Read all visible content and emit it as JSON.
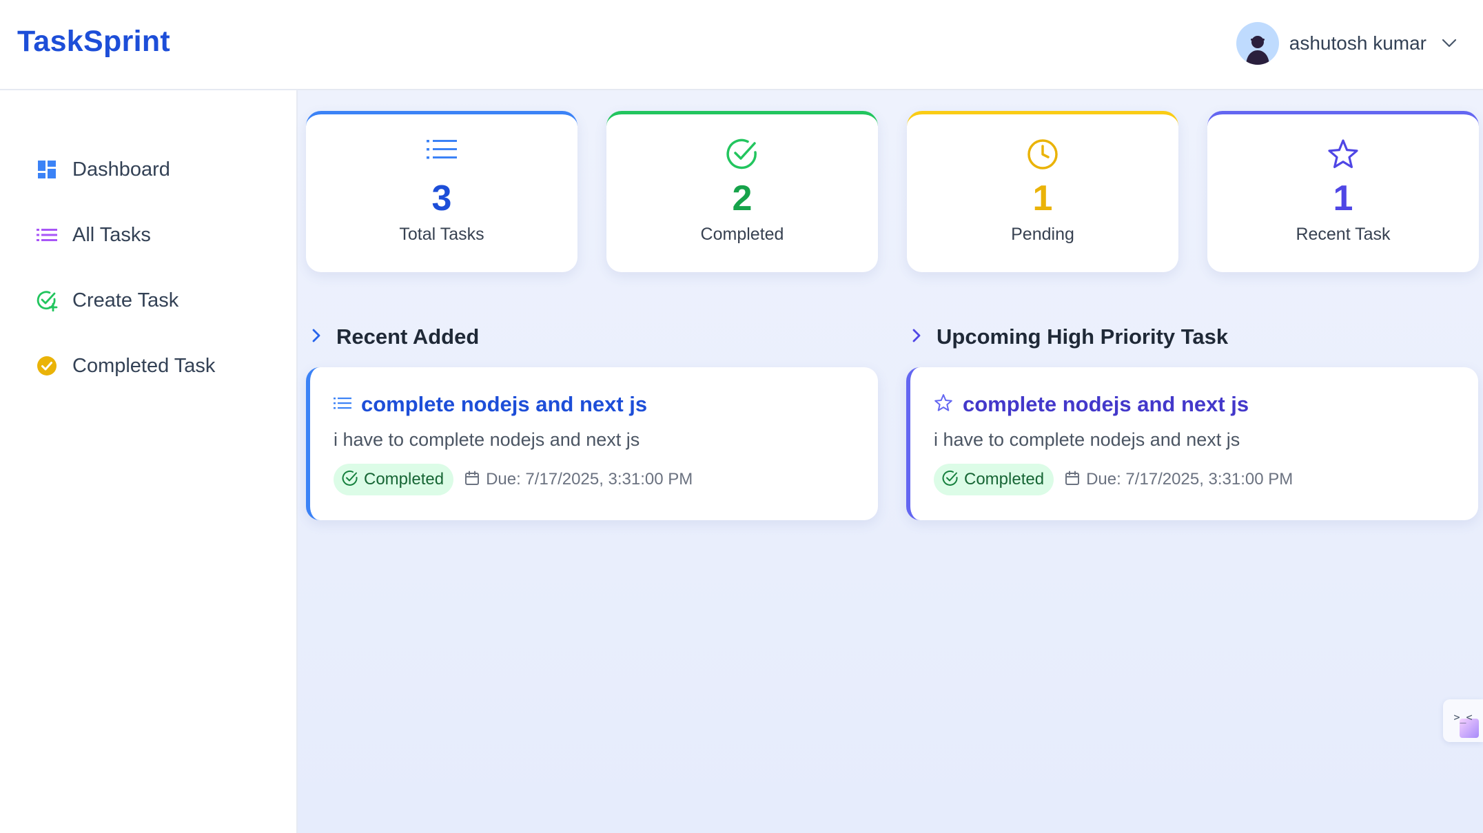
{
  "app": {
    "title": "TaskSprint"
  },
  "user": {
    "name": "ashutosh kumar"
  },
  "sidebar": {
    "items": [
      {
        "label": "Dashboard",
        "icon": "dashboard-icon"
      },
      {
        "label": "All Tasks",
        "icon": "list-icon"
      },
      {
        "label": "Create Task",
        "icon": "check-plus-icon"
      },
      {
        "label": "Completed Task",
        "icon": "check-circle-icon"
      }
    ]
  },
  "stats": [
    {
      "value": "3",
      "label": "Total Tasks",
      "color": "#1d4ed8",
      "icon": "list-icon"
    },
    {
      "value": "2",
      "label": "Completed",
      "color": "#16a34a",
      "icon": "check-circle-icon"
    },
    {
      "value": "1",
      "label": "Pending",
      "color": "#eab308",
      "icon": "clock-icon"
    },
    {
      "value": "1",
      "label": "Recent Task",
      "color": "#4f46e5",
      "icon": "star-icon"
    }
  ],
  "sections": {
    "recent": {
      "title": "Recent Added",
      "task": {
        "title": "complete nodejs and next js",
        "description": "i have to complete nodejs and next js",
        "status": "Completed",
        "due": "Due: 7/17/2025, 3:31:00 PM"
      }
    },
    "priority": {
      "title": "Upcoming High Priority Task",
      "task": {
        "title": "complete nodejs and next js",
        "description": "i have to complete nodejs and next js",
        "status": "Completed",
        "due": "Due: 7/17/2025, 3:31:00 PM"
      }
    }
  },
  "floating_button": {
    "label": ">_<"
  },
  "colors": {
    "brand": "#1d4ed8",
    "completed_badge_bg": "#dcfce7",
    "completed_badge_text": "#166534",
    "main_bg": "#eef2fd"
  }
}
